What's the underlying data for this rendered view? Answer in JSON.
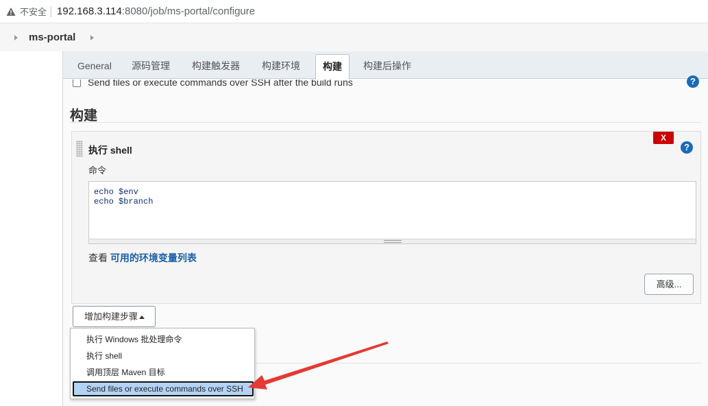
{
  "browser": {
    "security_label": "不安全",
    "url_host": "192.168.3.114",
    "url_path": ":8080/job/ms-portal/configure"
  },
  "breadcrumb": {
    "job_name": "ms-portal"
  },
  "tabs": [
    {
      "label": "General"
    },
    {
      "label": "源码管理"
    },
    {
      "label": "构建触发器"
    },
    {
      "label": "构建环境"
    },
    {
      "label": "构建",
      "active": true
    },
    {
      "label": "构建后操作"
    }
  ],
  "post_build_ssh": {
    "label": "Send files or execute commands over SSH after the build runs"
  },
  "build_section": {
    "title": "构建",
    "step": {
      "title": "执行 shell",
      "delete_label": "X",
      "command_label": "命令",
      "command_text": "echo $env\necho $branch",
      "env_prefix": "查看",
      "env_link": "可用的环境变量列表",
      "advanced_label": "高级..."
    },
    "add_step_label": "增加构建步骤"
  },
  "add_step_menu": {
    "items": [
      {
        "label": "执行 Windows 批处理命令"
      },
      {
        "label": "执行 shell"
      },
      {
        "label": "调用顶层 Maven 目标"
      },
      {
        "label": "Send files or execute commands over SSH",
        "highlighted": true
      }
    ]
  },
  "help_icon_glyph": "?",
  "colors": {
    "accent": "#1a6bb5",
    "delete": "#cc0000",
    "annotation_arrow": "#e53935",
    "highlight": "#b3d3f5"
  }
}
